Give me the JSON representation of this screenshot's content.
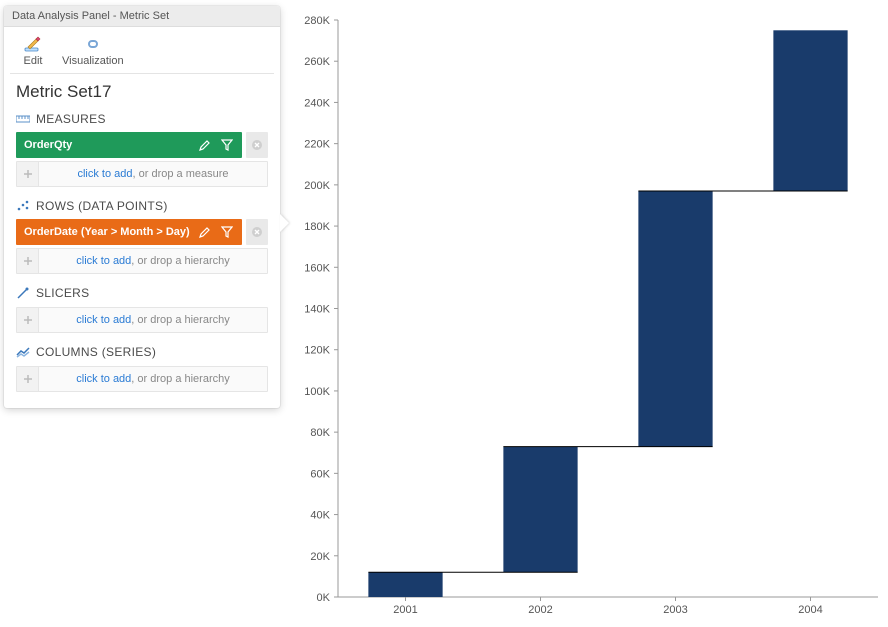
{
  "panel": {
    "title": "Data Analysis Panel - Metric Set",
    "toolbar": {
      "edit": "Edit",
      "visualization": "Visualization"
    },
    "metricset_name": "Metric Set17",
    "sections": {
      "measures": {
        "heading": "MEASURES",
        "chip": "OrderQty",
        "add_cta": "click to add",
        "add_rest": ", or drop a measure"
      },
      "rows": {
        "heading": "ROWS (DATA POINTS)",
        "chip": "OrderDate (Year > Month > Day)",
        "add_cta": "click to add",
        "add_rest": ", or drop a hierarchy"
      },
      "slicers": {
        "heading": "SLICERS",
        "add_cta": "click to add",
        "add_rest": ", or drop a hierarchy"
      },
      "columns": {
        "heading": "COLUMNS (SERIES)",
        "add_cta": "click to add",
        "add_rest": ", or drop a hierarchy"
      }
    }
  },
  "chart_data": {
    "type": "bar",
    "subtype": "waterfall",
    "categories": [
      "2001",
      "2002",
      "2003",
      "2004"
    ],
    "bar_start": [
      0,
      12000,
      73000,
      197000
    ],
    "bar_end": [
      12000,
      73000,
      197000,
      275000
    ],
    "ylim": [
      0,
      280000
    ],
    "ytick_interval": 20000,
    "ytick_labels": [
      "0K",
      "20K",
      "40K",
      "60K",
      "80K",
      "100K",
      "120K",
      "140K",
      "160K",
      "180K",
      "200K",
      "220K",
      "240K",
      "260K",
      "280K"
    ],
    "colors": {
      "bar": "#193b6b"
    }
  }
}
